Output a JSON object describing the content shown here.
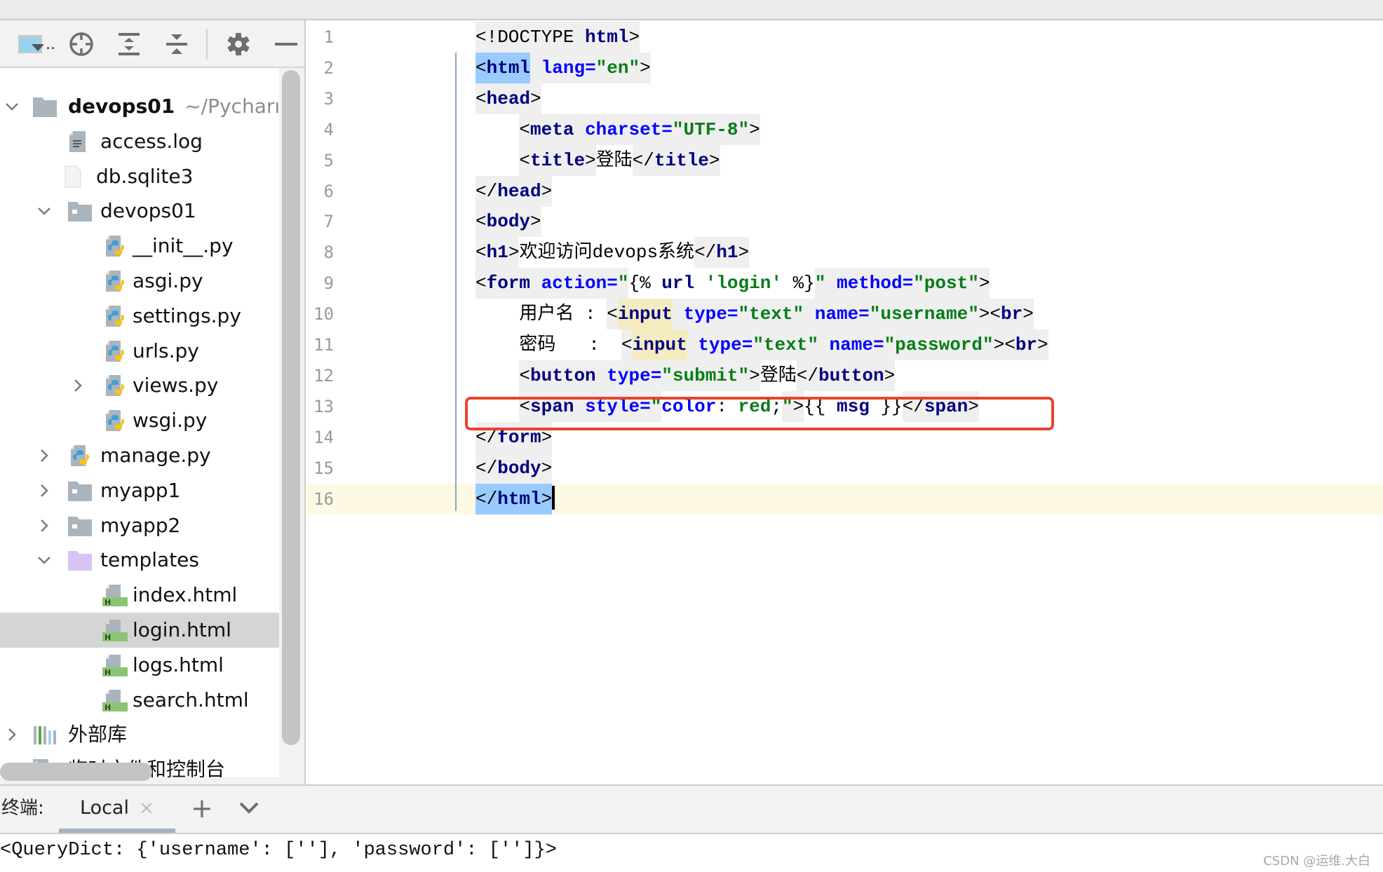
{
  "sidebar": {
    "toolbar": {
      "view_dropdown_icon": "project-view-dropdown-icon",
      "locate_icon": "locate-crosshair-icon",
      "expand_all_icon": "expand-all-icon",
      "collapse_all_icon": "collapse-all-icon",
      "settings_icon": "gear-icon",
      "hide_icon": "minus-icon",
      "view_ellipsis": ".."
    },
    "tree": [
      {
        "label": "devops01",
        "path": "~/Pycharı",
        "level": 0,
        "type": "folder",
        "expanded": true,
        "bold": true
      },
      {
        "label": "access.log",
        "level": 1,
        "type": "log"
      },
      {
        "label": "db.sqlite3",
        "level": 1,
        "type": "file"
      },
      {
        "label": "devops01",
        "level": 1,
        "type": "package",
        "expanded": true
      },
      {
        "label": "__init__.py",
        "level": 2,
        "type": "python"
      },
      {
        "label": "asgi.py",
        "level": 2,
        "type": "python"
      },
      {
        "label": "settings.py",
        "level": 2,
        "type": "python"
      },
      {
        "label": "urls.py",
        "level": 2,
        "type": "python"
      },
      {
        "label": "views.py",
        "level": 2,
        "type": "python",
        "expanded": false
      },
      {
        "label": "wsgi.py",
        "level": 2,
        "type": "python"
      },
      {
        "label": "manage.py",
        "level": 1,
        "type": "python",
        "expanded": false
      },
      {
        "label": "myapp1",
        "level": 1,
        "type": "package",
        "expanded": false
      },
      {
        "label": "myapp2",
        "level": 1,
        "type": "package",
        "expanded": false
      },
      {
        "label": "templates",
        "level": 1,
        "type": "templates-folder",
        "expanded": true
      },
      {
        "label": "index.html",
        "level": 2,
        "type": "html"
      },
      {
        "label": "login.html",
        "level": 2,
        "type": "html",
        "selected": true
      },
      {
        "label": "logs.html",
        "level": 2,
        "type": "html"
      },
      {
        "label": "search.html",
        "level": 2,
        "type": "html"
      },
      {
        "label": "外部库",
        "level": 0,
        "type": "library",
        "expanded": false
      },
      {
        "label": "临时文件和控制台",
        "level": 0,
        "type": "scratches"
      }
    ]
  },
  "editor": {
    "current_line": 16,
    "highlight_box_line": 13,
    "lines": [
      {
        "n": "1",
        "tokens": [
          [
            "<!DOCTYPE ",
            "plain",
            "bg"
          ],
          [
            "html",
            "tag",
            "bg"
          ],
          [
            ">",
            "plain",
            "bg"
          ]
        ]
      },
      {
        "n": "2",
        "tokens": [
          [
            "<",
            "plain",
            "bgsel"
          ],
          [
            "html",
            "tag",
            "bgsel"
          ],
          [
            " ",
            "plain",
            "bg"
          ],
          [
            "lang",
            "attr",
            "bg"
          ],
          [
            "=",
            "attr",
            "bg"
          ],
          [
            "\"en\"",
            "str",
            "bg"
          ],
          [
            ">",
            "plain",
            "bg"
          ]
        ]
      },
      {
        "n": "3",
        "tokens": [
          [
            "<",
            "plain",
            "bg"
          ],
          [
            "head",
            "tag",
            "bg"
          ],
          [
            ">",
            "plain",
            "bg"
          ]
        ]
      },
      {
        "n": "4",
        "indent": "    ",
        "tokens": [
          [
            "<",
            "plain",
            "bg"
          ],
          [
            "meta",
            "tag",
            "bg"
          ],
          [
            " ",
            "plain",
            "bg"
          ],
          [
            "charset",
            "attr",
            "bg"
          ],
          [
            "=",
            "attr",
            "bg"
          ],
          [
            "\"UTF-8\"",
            "str",
            "bg"
          ],
          [
            ">",
            "plain",
            "bg"
          ]
        ]
      },
      {
        "n": "5",
        "indent": "    ",
        "tokens": [
          [
            "<",
            "plain",
            "bg"
          ],
          [
            "title",
            "tag",
            "bg"
          ],
          [
            ">",
            "plain",
            "bg"
          ],
          [
            "登陆",
            "plain",
            ""
          ],
          [
            "</",
            "plain",
            "bg"
          ],
          [
            "title",
            "tag",
            "bg"
          ],
          [
            ">",
            "plain",
            "bg"
          ]
        ]
      },
      {
        "n": "6",
        "tokens": [
          [
            "</",
            "plain",
            "bg"
          ],
          [
            "head",
            "tag",
            "bg"
          ],
          [
            ">",
            "plain",
            "bg"
          ]
        ]
      },
      {
        "n": "7",
        "tokens": [
          [
            "<",
            "plain",
            "bg"
          ],
          [
            "body",
            "tag",
            "bg"
          ],
          [
            ">",
            "plain",
            "bg"
          ]
        ]
      },
      {
        "n": "8",
        "tokens": [
          [
            "<",
            "plain",
            "bg"
          ],
          [
            "h1",
            "tag",
            "bg"
          ],
          [
            ">",
            "plain",
            "bg"
          ],
          [
            "欢迎访问devops系统",
            "plain",
            ""
          ],
          [
            "</",
            "plain",
            "bg"
          ],
          [
            "h1",
            "tag",
            "bg"
          ],
          [
            ">",
            "plain",
            "bg"
          ]
        ]
      },
      {
        "n": "9",
        "tokens": [
          [
            "<",
            "plain",
            "bg"
          ],
          [
            "form",
            "tag",
            "bg"
          ],
          [
            " ",
            "plain",
            "bg"
          ],
          [
            "action",
            "attr",
            "bg"
          ],
          [
            "=",
            "attr",
            "bg"
          ],
          [
            "\"",
            "str",
            "bg"
          ],
          [
            "{% ",
            "plain",
            ""
          ],
          [
            "url",
            "tpl",
            ""
          ],
          [
            " ",
            "plain",
            ""
          ],
          [
            "'login'",
            "str",
            ""
          ],
          [
            " %}",
            "plain",
            ""
          ],
          [
            "\"",
            "str",
            "bg"
          ],
          [
            " ",
            "plain",
            "bg"
          ],
          [
            "method",
            "attr",
            "bg"
          ],
          [
            "=",
            "attr",
            "bg"
          ],
          [
            "\"post\"",
            "str",
            "bg"
          ],
          [
            ">",
            "plain",
            "bg"
          ]
        ]
      },
      {
        "n": "10",
        "indent": "    ",
        "tokens": [
          [
            "用户名 : ",
            "plain",
            ""
          ],
          [
            "<",
            "plain",
            "bg"
          ],
          [
            "input",
            "tag",
            "bgy"
          ],
          [
            " ",
            "plain",
            "bg"
          ],
          [
            "type",
            "attr",
            "bg"
          ],
          [
            "=",
            "attr",
            "bg"
          ],
          [
            "\"text\"",
            "str",
            "bg"
          ],
          [
            " ",
            "plain",
            "bg"
          ],
          [
            "name",
            "attr",
            "bg"
          ],
          [
            "=",
            "attr",
            "bg"
          ],
          [
            "\"username\"",
            "str",
            "bg"
          ],
          [
            "><",
            "plain",
            "bg"
          ],
          [
            "br",
            "tag",
            "bg"
          ],
          [
            ">",
            "plain",
            "bg"
          ]
        ]
      },
      {
        "n": "11",
        "indent": "    ",
        "tokens": [
          [
            "密码   :  ",
            "plain",
            ""
          ],
          [
            "<",
            "plain",
            "bg"
          ],
          [
            "input",
            "tag",
            "bgy"
          ],
          [
            " ",
            "plain",
            "bg"
          ],
          [
            "type",
            "attr",
            "bg"
          ],
          [
            "=",
            "attr",
            "bg"
          ],
          [
            "\"text\"",
            "str",
            "bg"
          ],
          [
            " ",
            "plain",
            "bg"
          ],
          [
            "name",
            "attr",
            "bg"
          ],
          [
            "=",
            "attr",
            "bg"
          ],
          [
            "\"password\"",
            "str",
            "bg"
          ],
          [
            "><",
            "plain",
            "bg"
          ],
          [
            "br",
            "tag",
            "bg"
          ],
          [
            ">",
            "plain",
            "bg"
          ]
        ]
      },
      {
        "n": "12",
        "indent": "    ",
        "tokens": [
          [
            "<",
            "plain",
            "bg"
          ],
          [
            "button",
            "tag",
            "bg"
          ],
          [
            " ",
            "plain",
            "bg"
          ],
          [
            "type",
            "attr",
            "bg"
          ],
          [
            "=",
            "attr",
            "bg"
          ],
          [
            "\"submit\"",
            "str",
            "bg"
          ],
          [
            ">",
            "plain",
            "bg"
          ],
          [
            "登陆",
            "plain",
            ""
          ],
          [
            "</",
            "plain",
            "bg"
          ],
          [
            "button",
            "tag",
            "bg"
          ],
          [
            ">",
            "plain",
            "bg"
          ]
        ]
      },
      {
        "n": "13",
        "indent": "    ",
        "tokens": [
          [
            "<",
            "plain",
            "bg"
          ],
          [
            "span",
            "tag",
            "bg"
          ],
          [
            " ",
            "plain",
            "bg"
          ],
          [
            "style",
            "attr",
            "bg"
          ],
          [
            "=",
            "attr",
            "bg"
          ],
          [
            "\"",
            "str",
            "bg"
          ],
          [
            "color",
            "attr",
            ""
          ],
          [
            ": ",
            "plain",
            ""
          ],
          [
            "red",
            "str",
            ""
          ],
          [
            ";",
            "plain",
            ""
          ],
          [
            "\"",
            "str",
            "bg"
          ],
          [
            ">",
            "plain",
            "bg"
          ],
          [
            "{{ ",
            "plain",
            ""
          ],
          [
            "msg",
            "tpl",
            ""
          ],
          [
            " }}",
            "plain",
            ""
          ],
          [
            "</",
            "plain",
            "bg"
          ],
          [
            "span",
            "tag",
            "bg"
          ],
          [
            ">",
            "plain",
            "bg"
          ]
        ]
      },
      {
        "n": "14",
        "tokens": [
          [
            "</",
            "plain",
            "bg"
          ],
          [
            "form",
            "tag",
            "bg"
          ],
          [
            ">",
            "plain",
            "bg"
          ]
        ]
      },
      {
        "n": "15",
        "tokens": [
          [
            "</",
            "plain",
            "bg"
          ],
          [
            "body",
            "tag",
            "bg"
          ],
          [
            ">",
            "plain",
            "bg"
          ]
        ]
      },
      {
        "n": "16",
        "tokens": [
          [
            "</",
            "plain",
            "bgsel"
          ],
          [
            "html",
            "tag",
            "bgsel"
          ],
          [
            ">",
            "plain",
            "bgsel"
          ]
        ],
        "caret": true
      }
    ],
    "colors": {
      "tag": "#000080",
      "attribute": "#0000ff",
      "string": "#067d17",
      "highlight_box": "#e8432e",
      "current_line_bg": "#fef9e4",
      "selection_bg": "#99cbff"
    }
  },
  "terminal": {
    "label": "终端:",
    "tab_label": "Local",
    "close_glyph": "×",
    "add_glyph": "+",
    "output": "<QueryDict: {'username': [''], 'password': ['']}>"
  },
  "watermark": "CSDN @运维.大白"
}
